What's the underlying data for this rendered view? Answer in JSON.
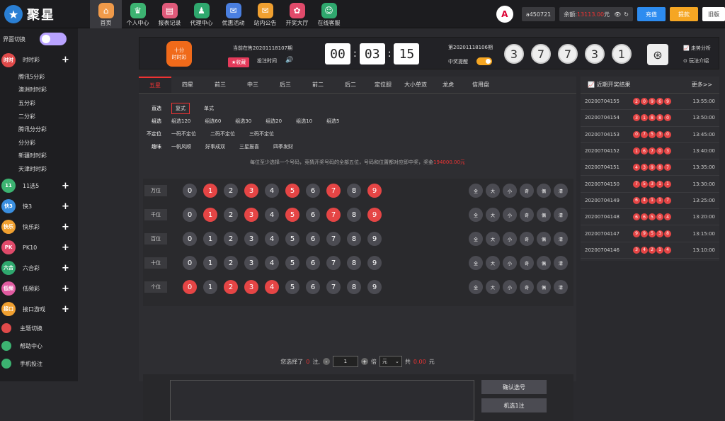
{
  "brand": {
    "logo_text": "聚星"
  },
  "nav": [
    {
      "label": "首页",
      "color": "#f09a4a",
      "icon": "home-icon",
      "glyph": "⌂"
    },
    {
      "label": "个人中心",
      "color": "#3cb371",
      "icon": "crown-icon",
      "glyph": "♛"
    },
    {
      "label": "报表记录",
      "color": "#e05a7a",
      "icon": "report-icon",
      "glyph": "▤"
    },
    {
      "label": "代理中心",
      "color": "#2fa86e",
      "icon": "agent-icon",
      "glyph": "♟"
    },
    {
      "label": "优惠活动",
      "color": "#4a7fe0",
      "icon": "gift-icon",
      "glyph": "✉"
    },
    {
      "label": "站内公告",
      "color": "#f0a030",
      "icon": "mail-icon",
      "glyph": "✉"
    },
    {
      "label": "开奖大厅",
      "color": "#e04a6a",
      "icon": "lottery-icon",
      "glyph": "✿"
    },
    {
      "label": "在线客服",
      "color": "#2fa86e",
      "icon": "service-icon",
      "glyph": "☺"
    }
  ],
  "user": {
    "username": "a450721",
    "balance_label": "余额:",
    "balance_value": "13113.00",
    "balance_unit": "元",
    "deposit": "充值",
    "withdraw": "提款",
    "switch": "旧版"
  },
  "sidebar": {
    "theme_label": "界面切换",
    "categories": [
      {
        "label": "时时彩",
        "color": "#e04a4a",
        "badge": "时时"
      },
      {
        "label": "11选5",
        "color": "#3cb371",
        "badge": "11"
      },
      {
        "label": "快3",
        "color": "#3a8fe0",
        "badge": "快3"
      },
      {
        "label": "快乐彩",
        "color": "#f0a030",
        "badge": "快乐"
      },
      {
        "label": "PK10",
        "color": "#e04a6a",
        "badge": "PK"
      },
      {
        "label": "六合彩",
        "color": "#2fa86e",
        "badge": "六合"
      },
      {
        "label": "低频彩",
        "color": "#e05aa0",
        "badge": "低频"
      },
      {
        "label": "接口游戏",
        "color": "#f0a030",
        "badge": "接口"
      }
    ],
    "sub_items": [
      "腾讯5分彩",
      "澳洲时时彩",
      "五分彩",
      "二分彩",
      "腾讯分分彩",
      "分分彩",
      "新疆时时彩",
      "天津时时彩"
    ],
    "extras": [
      {
        "label": "主题切换",
        "color": "#e04a4a"
      },
      {
        "label": "帮助中心",
        "color": "#3cb371"
      },
      {
        "label": "手机投注",
        "color": "#3cb371"
      }
    ]
  },
  "game": {
    "logo_line1": "十分",
    "logo_line2": "时时彩",
    "current_issue": "当前在售20201118107期",
    "favorite": "★收藏",
    "draw_time": "投注时间",
    "countdown": [
      "00",
      "03",
      "15"
    ],
    "prev_issue": "第20201118106期",
    "win_remind": "中奖提醒",
    "draw_numbers": [
      "3",
      "7",
      "7",
      "3",
      "1"
    ],
    "trend": "走势分析",
    "rules": "玩法介绍"
  },
  "tabs": [
    "五星",
    "四星",
    "前三",
    "中三",
    "后三",
    "前二",
    "后二",
    "定位胆",
    "大小单双",
    "龙虎",
    "信用盘"
  ],
  "plays": [
    {
      "label": "直选",
      "options": [
        "复式",
        "单式"
      ]
    },
    {
      "label": "组选",
      "options": [
        "组选120",
        "组选60",
        "组选30",
        "组选20",
        "组选10",
        "组选5"
      ]
    },
    {
      "label": "不定位",
      "options": [
        "一码不定位",
        "二码不定位",
        "三码不定位"
      ]
    },
    {
      "label": "趣味",
      "options": [
        "一帆风顺",
        "好事成双",
        "三星报喜",
        "四季发财"
      ]
    }
  ],
  "hint": {
    "text": "每位至少选择一个号码，竞猜开奖号码的全部五位，号码和位置都对应即中奖，奖金",
    "prize": "194000.00元"
  },
  "board": {
    "positions": [
      "万位",
      "千位",
      "百位",
      "十位",
      "个位"
    ],
    "numbers": [
      "0",
      "1",
      "2",
      "3",
      "4",
      "5",
      "6",
      "7",
      "8",
      "9"
    ],
    "quick": [
      "全",
      "大",
      "小",
      "奇",
      "偶",
      "清"
    ],
    "hot_rows": [
      [
        1,
        3,
        5,
        7,
        9
      ],
      [
        1,
        3,
        5,
        7,
        9
      ],
      [],
      [],
      [
        0,
        2,
        3,
        4
      ]
    ]
  },
  "bet": {
    "prefix": "您选择了",
    "count": "0",
    "mid": "注,",
    "minus": "-",
    "multiple": "1",
    "plus": "+",
    "times": "倍",
    "unit": "元",
    "total_prefix": "共",
    "total": "0.00",
    "total_unit": "元",
    "confirm": "确认选号",
    "random": "机选1注"
  },
  "results": {
    "title": "近期开奖结果",
    "more": "更多>>",
    "rows": [
      {
        "issue": "20200704155",
        "nums": [
          "2",
          "0",
          "9",
          "6",
          "9"
        ],
        "time": "13:55:00"
      },
      {
        "issue": "20200704154",
        "nums": [
          "3",
          "1",
          "8",
          "8",
          "0"
        ],
        "time": "13:50:00"
      },
      {
        "issue": "20200704153",
        "nums": [
          "0",
          "7",
          "5",
          "3",
          "0"
        ],
        "time": "13:45:00"
      },
      {
        "issue": "20200704152",
        "nums": [
          "1",
          "6",
          "7",
          "0",
          "3"
        ],
        "time": "13:40:00"
      },
      {
        "issue": "20200704151",
        "nums": [
          "4",
          "3",
          "9",
          "8",
          "7"
        ],
        "time": "13:35:00"
      },
      {
        "issue": "20200704150",
        "nums": [
          "7",
          "5",
          "3",
          "1",
          "1"
        ],
        "time": "13:30:00"
      },
      {
        "issue": "20200704149",
        "nums": [
          "6",
          "4",
          "1",
          "1",
          "7"
        ],
        "time": "13:25:00"
      },
      {
        "issue": "20200704148",
        "nums": [
          "6",
          "6",
          "5",
          "0",
          "4"
        ],
        "time": "13:20:00"
      },
      {
        "issue": "20200704147",
        "nums": [
          "9",
          "9",
          "5",
          "3",
          "8"
        ],
        "time": "13:15:00"
      },
      {
        "issue": "20200704146",
        "nums": [
          "3",
          "4",
          "2",
          "1",
          "4"
        ],
        "time": "13:10:00"
      }
    ]
  }
}
